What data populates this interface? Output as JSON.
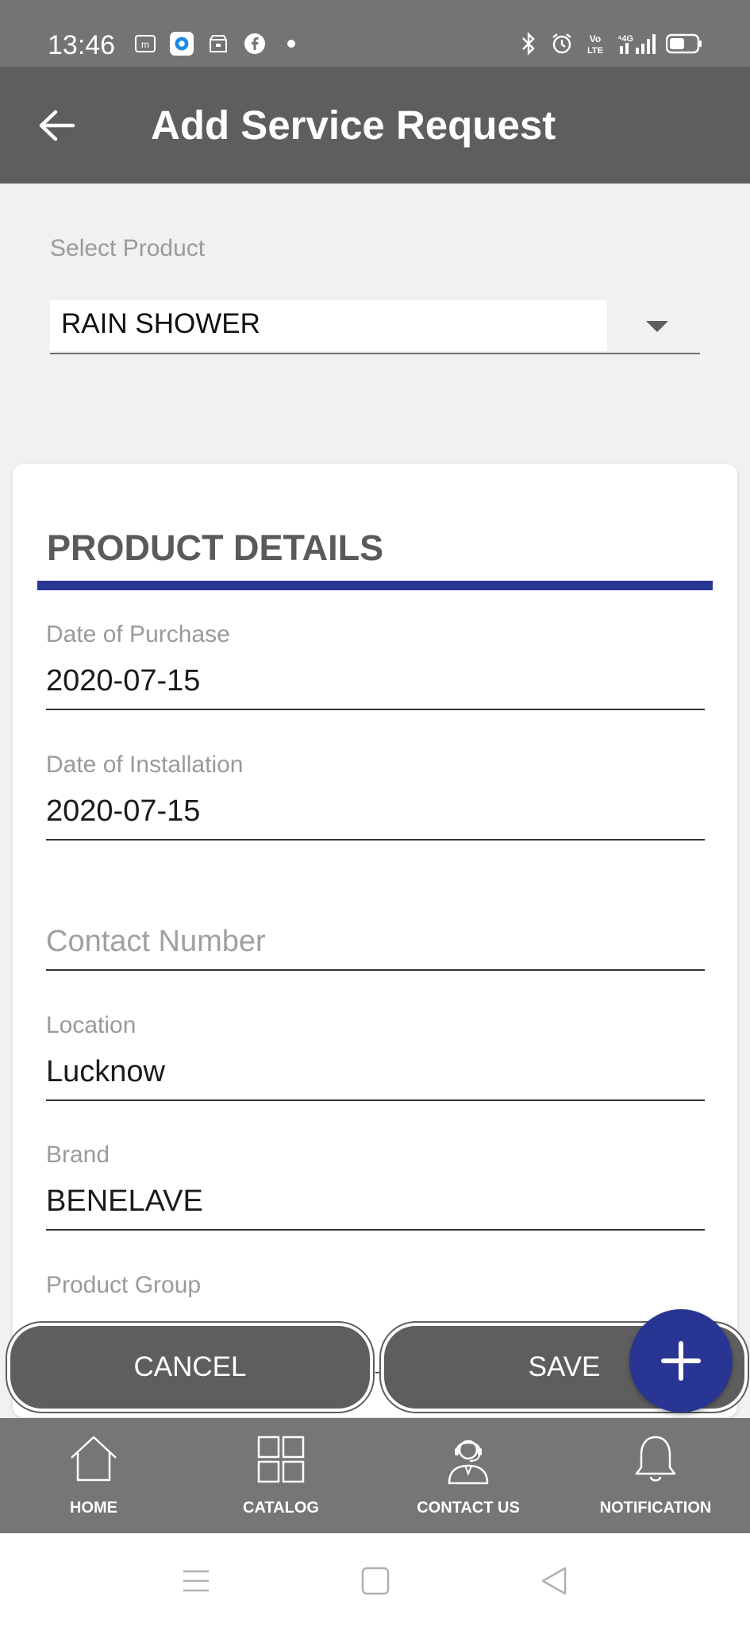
{
  "status_bar": {
    "time": "13:46",
    "left_icons": [
      "mi-icon",
      "browser-icon",
      "store-icon",
      "facebook-icon",
      "dot-icon"
    ],
    "right_icons": [
      "bluetooth-icon",
      "alarm-icon",
      "volte-icon",
      "signal-4g-icon",
      "battery-icon"
    ]
  },
  "app_bar": {
    "title": "Add Service Request"
  },
  "product_select": {
    "label": "Select Product",
    "value": "RAIN SHOWER"
  },
  "card": {
    "title": "PRODUCT DETAILS",
    "accent_color": "#283593",
    "fields": [
      {
        "label": "Date of Purchase",
        "value": "2020-07-15"
      },
      {
        "label": "Date of Installation",
        "value": "2020-07-15"
      },
      {
        "label": "",
        "placeholder": "Contact Number",
        "value": ""
      },
      {
        "label": "Location",
        "value": "Lucknow"
      },
      {
        "label": "Brand",
        "value": "BENELAVE"
      },
      {
        "label": "Product Group",
        "value": ""
      }
    ]
  },
  "actions": {
    "cancel_label": "CANCEL",
    "save_label": "SAVE",
    "separator": "-"
  },
  "bottom_nav": {
    "items": [
      {
        "label": "HOME",
        "icon": "home-icon"
      },
      {
        "label": "CATALOG",
        "icon": "grid-icon"
      },
      {
        "label": "CONTACT US",
        "icon": "support-agent-icon"
      },
      {
        "label": "NOTIFICATION",
        "icon": "bell-icon"
      }
    ]
  },
  "colors": {
    "app_bar": "#5e5e5e",
    "status_bar": "#747474",
    "accent": "#283593",
    "bottom_nav": "#767676"
  }
}
